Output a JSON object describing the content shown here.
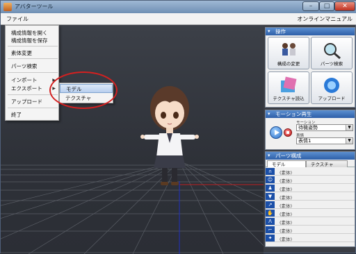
{
  "window": {
    "title": "アバターツール"
  },
  "menubar": {
    "file": "ファイル",
    "manual": "オンラインマニュアル"
  },
  "file_menu": {
    "items": [
      "構成情報を開く",
      "構成情報を保存",
      "素体変更",
      "パーツ検索",
      "インポート",
      "エクスポート",
      "アップロード",
      "終了"
    ]
  },
  "submenu": {
    "items": [
      "モデル",
      "テクスチャ"
    ],
    "active": "モデル"
  },
  "operations": {
    "header": "操作",
    "buttons": [
      "構成の変更",
      "パーツ検索",
      "テクスチャ読込",
      "アップロード"
    ]
  },
  "motion": {
    "header": "モーション再生",
    "motion_label": "モーション",
    "motion_value": "待機姿勢",
    "expression_label": "表情",
    "expression_value": "表情1"
  },
  "parts": {
    "header": "パーツ構成",
    "tabs": [
      "モデル",
      "テクスチャ"
    ],
    "rows": [
      "(素体)",
      "(素体)",
      "(素体)",
      "(素体)",
      "(素体)",
      "(素体)",
      "(素体)",
      "(素体)",
      "(素体)"
    ],
    "row_icons": [
      "hair-icon",
      "face-icon",
      "body-icon",
      "tops-icon",
      "arm-icon",
      "hand-icon",
      "bottoms-icon",
      "leg-icon",
      "accessory-icon"
    ]
  },
  "colors": {
    "accent": "#2e5fa8",
    "highlight": "#d42020",
    "viewport_bg": "#2e3138"
  }
}
